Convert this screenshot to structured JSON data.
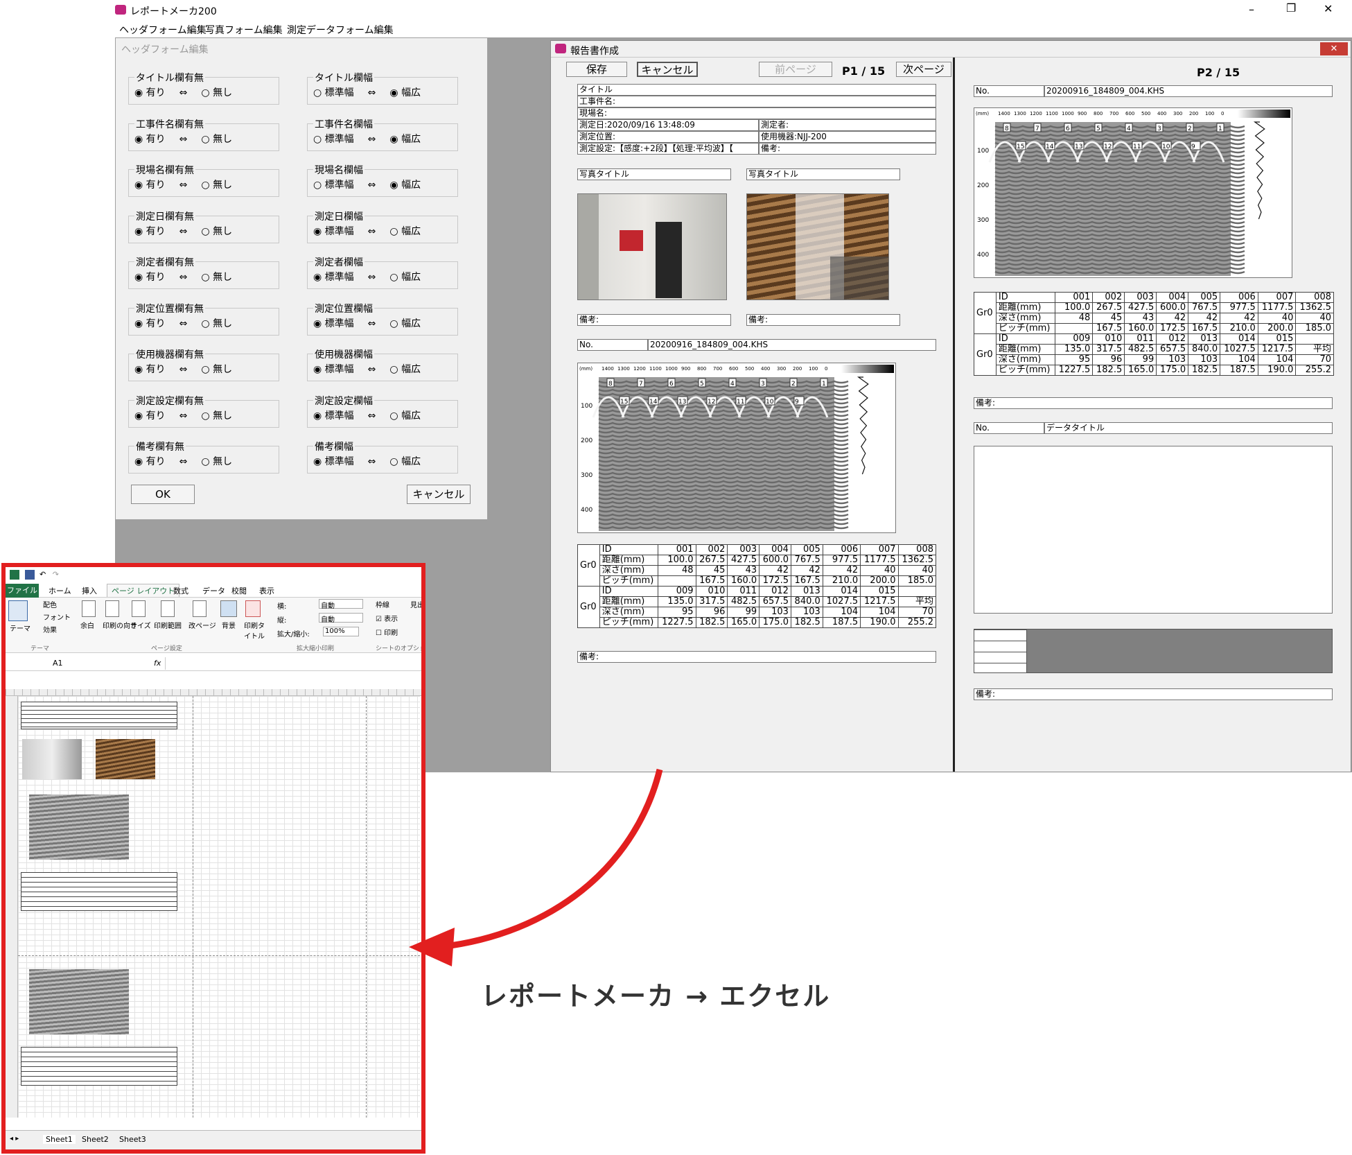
{
  "app": {
    "title": "レポートメーカ200",
    "menu": [
      "ヘッダフォーム編集",
      "写真フォーム編集",
      "測定データフォーム編集"
    ],
    "win_controls": {
      "min": "–",
      "max": "❐",
      "close": "✕"
    }
  },
  "header_form": {
    "title": "ヘッダフォーム編集",
    "left_groups": [
      {
        "label": "タイトル欄有無",
        "opt1": "有り",
        "opt2": "無し",
        "sel": 1
      },
      {
        "label": "工事件名欄有無",
        "opt1": "有り",
        "opt2": "無し",
        "sel": 1
      },
      {
        "label": "現場名欄有無",
        "opt1": "有り",
        "opt2": "無し",
        "sel": 1
      },
      {
        "label": "測定日欄有無",
        "opt1": "有り",
        "opt2": "無し",
        "sel": 1
      },
      {
        "label": "測定者欄有無",
        "opt1": "有り",
        "opt2": "無し",
        "sel": 1
      },
      {
        "label": "測定位置欄有無",
        "opt1": "有り",
        "opt2": "無し",
        "sel": 1
      },
      {
        "label": "使用機器欄有無",
        "opt1": "有り",
        "opt2": "無し",
        "sel": 1
      },
      {
        "label": "測定設定欄有無",
        "opt1": "有り",
        "opt2": "無し",
        "sel": 1
      },
      {
        "label": "備考欄有無",
        "opt1": "有り",
        "opt2": "無し",
        "sel": 1
      }
    ],
    "right_groups": [
      {
        "label": "タイトル欄幅",
        "opt1": "標準幅",
        "opt2": "幅広",
        "sel": 2
      },
      {
        "label": "工事件名欄幅",
        "opt1": "標準幅",
        "opt2": "幅広",
        "sel": 2
      },
      {
        "label": "現場名欄幅",
        "opt1": "標準幅",
        "opt2": "幅広",
        "sel": 2
      },
      {
        "label": "測定日欄幅",
        "opt1": "標準幅",
        "opt2": "幅広",
        "sel": 1
      },
      {
        "label": "測定者欄幅",
        "opt1": "標準幅",
        "opt2": "幅広",
        "sel": 1
      },
      {
        "label": "測定位置欄幅",
        "opt1": "標準幅",
        "opt2": "幅広",
        "sel": 1
      },
      {
        "label": "使用機器欄幅",
        "opt1": "標準幅",
        "opt2": "幅広",
        "sel": 1
      },
      {
        "label": "測定設定欄幅",
        "opt1": "標準幅",
        "opt2": "幅広",
        "sel": 1
      },
      {
        "label": "備考欄幅",
        "opt1": "標準幅",
        "opt2": "幅広",
        "sel": 1
      }
    ],
    "arrow": "⇔",
    "ok": "OK",
    "cancel": "キャンセル"
  },
  "report": {
    "title": "報告書作成",
    "save": "保存",
    "cancel": "キャンセル",
    "prev": "前ページ",
    "page1": "P1 / 15",
    "next": "次ページ",
    "page2": "P2 / 15",
    "header_lines": [
      "タイトル",
      "工事件名:",
      "現場名:"
    ],
    "date": "測定日:2020/09/16 13:48:09",
    "operator": "測定者:",
    "position": "測定位置:",
    "device": "使用機器:NJJ-200",
    "settings": "測定設定:【感度:+2段】【処理:平均波】【",
    "remarks_h": "備考:",
    "photo_title": "写真タイトル",
    "photo_remark": "備考:",
    "no_label": "No.",
    "file": "20200916_184809_004.KHS",
    "data_title": "データタイトル",
    "remark": "備考:",
    "axis_top": [
      "1400",
      "1300",
      "1200",
      "1100",
      "1000",
      "900",
      "800",
      "700",
      "600",
      "500",
      "400",
      "300",
      "200",
      "100",
      "0"
    ],
    "axis_left": [
      "100",
      "200",
      "300",
      "400"
    ],
    "unit": "(mm)",
    "markers_top": [
      "8",
      "7",
      "6",
      "5",
      "4",
      "3",
      "2",
      "1"
    ],
    "markers_bot": [
      "15",
      "14",
      "13",
      "12",
      "11",
      "10",
      "9"
    ],
    "group": "Gr0",
    "table": [
      [
        "ID",
        "001",
        "002",
        "003",
        "004",
        "005",
        "006",
        "007",
        "008"
      ],
      [
        "距離(mm)",
        "100.0",
        "267.5",
        "427.5",
        "600.0",
        "767.5",
        "977.5",
        "1177.5",
        "1362.5"
      ],
      [
        "深さ(mm)",
        "48",
        "45",
        "43",
        "42",
        "42",
        "42",
        "40",
        "40"
      ],
      [
        "ピッチ(mm)",
        "",
        "167.5",
        "160.0",
        "172.5",
        "167.5",
        "210.0",
        "200.0",
        "185.0"
      ],
      [
        "ID",
        "009",
        "010",
        "011",
        "012",
        "013",
        "014",
        "015",
        ""
      ],
      [
        "距離(mm)",
        "135.0",
        "317.5",
        "482.5",
        "657.5",
        "840.0",
        "1027.5",
        "1217.5",
        "平均"
      ],
      [
        "深さ(mm)",
        "95",
        "96",
        "99",
        "103",
        "103",
        "104",
        "104",
        "70"
      ],
      [
        "ピッチ(mm)",
        "1227.5",
        "182.5",
        "165.0",
        "175.0",
        "182.5",
        "187.5",
        "190.0",
        "255.2"
      ]
    ]
  },
  "excel": {
    "tabs": [
      "ファイル",
      "ホーム",
      "挿入",
      "ページ レイアウト",
      "数式",
      "データ",
      "校閲",
      "表示"
    ],
    "ribbon": {
      "theme": "テーマ",
      "colors": "配色",
      "fonts": "フォント",
      "effects": "効果",
      "margins": "余白",
      "orientation": "印刷の向き",
      "size": "サイズ",
      "print_area": "印刷範囲",
      "breaks": "改ページ",
      "background": "背景",
      "print_titles": "印刷タイトル",
      "width": "横:",
      "height": "縦:",
      "auto": "自動",
      "scale": "拡大/縮小:",
      "scale_val": "100%",
      "gridlines": "枠線",
      "view": "表示",
      "print": "印刷",
      "headings": "見出",
      "grp_theme": "テーマ",
      "grp_page": "ページ設定",
      "grp_fit": "拡大縮小印刷",
      "grp_sheet": "シートのオプション"
    },
    "namebox": "A1",
    "fx": "fx",
    "sheets": [
      "Sheet1",
      "Sheet2",
      "Sheet3"
    ]
  },
  "caption": "レポートメーカ → エクセル",
  "colors": {
    "accent_red": "#e21f1f",
    "excel_green": "#217346"
  }
}
